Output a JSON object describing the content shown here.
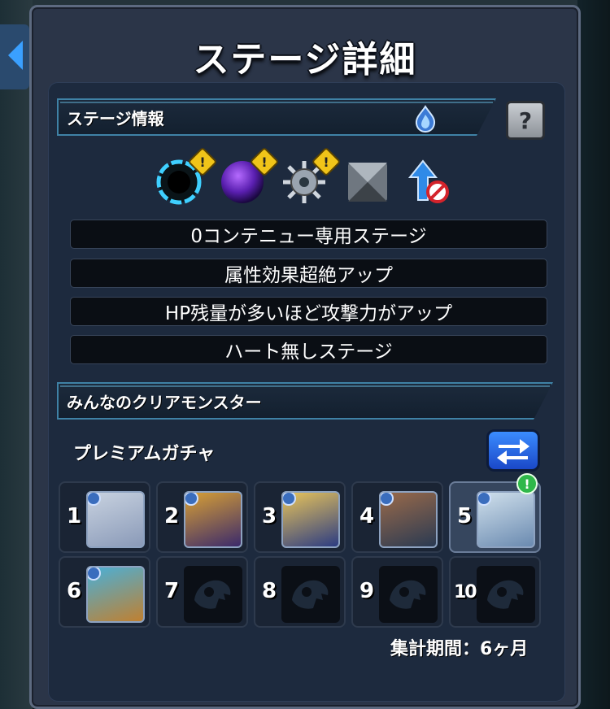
{
  "modal": {
    "title": "ステージ詳細"
  },
  "stage_info": {
    "header": "ステージ情報",
    "help_label": "?",
    "gimmicks": [
      {
        "icon": "black-hole-icon",
        "warning": true
      },
      {
        "icon": "purple-orb-icon",
        "warning": true
      },
      {
        "icon": "mine-icon",
        "warning": true
      },
      {
        "icon": "block-icon",
        "warning": false
      },
      {
        "icon": "speed-down-prohibit-icon",
        "warning": false
      }
    ],
    "warning_mark": "!",
    "rules": [
      "0コンテニュー専用ステージ",
      "属性効果超絶アップ",
      "HP残量が多いほど攻撃力がアップ",
      "ハート無しステージ"
    ]
  },
  "clear_monsters": {
    "header": "みんなのクリアモンスター",
    "gacha_label": "プレミアムガチャ",
    "slots": [
      {
        "rank": "1",
        "filled": true,
        "colors": [
          "#c8d2e0",
          "#8a9ab8"
        ]
      },
      {
        "rank": "2",
        "filled": true,
        "colors": [
          "#d8a035",
          "#3b2a6b"
        ]
      },
      {
        "rank": "3",
        "filled": true,
        "colors": [
          "#e8c45a",
          "#2c3c82"
        ]
      },
      {
        "rank": "4",
        "filled": true,
        "colors": [
          "#9a6a4a",
          "#2a3a52"
        ]
      },
      {
        "rank": "5",
        "filled": true,
        "colors": [
          "#d0e0ec",
          "#6a8ab0"
        ],
        "badge": "!"
      },
      {
        "rank": "6",
        "filled": true,
        "colors": [
          "#4ab0d8",
          "#c08030"
        ]
      },
      {
        "rank": "7",
        "filled": false
      },
      {
        "rank": "8",
        "filled": false
      },
      {
        "rank": "9",
        "filled": false
      },
      {
        "rank": "10",
        "filled": false
      }
    ],
    "period": "集計期間：6ヶ月"
  }
}
